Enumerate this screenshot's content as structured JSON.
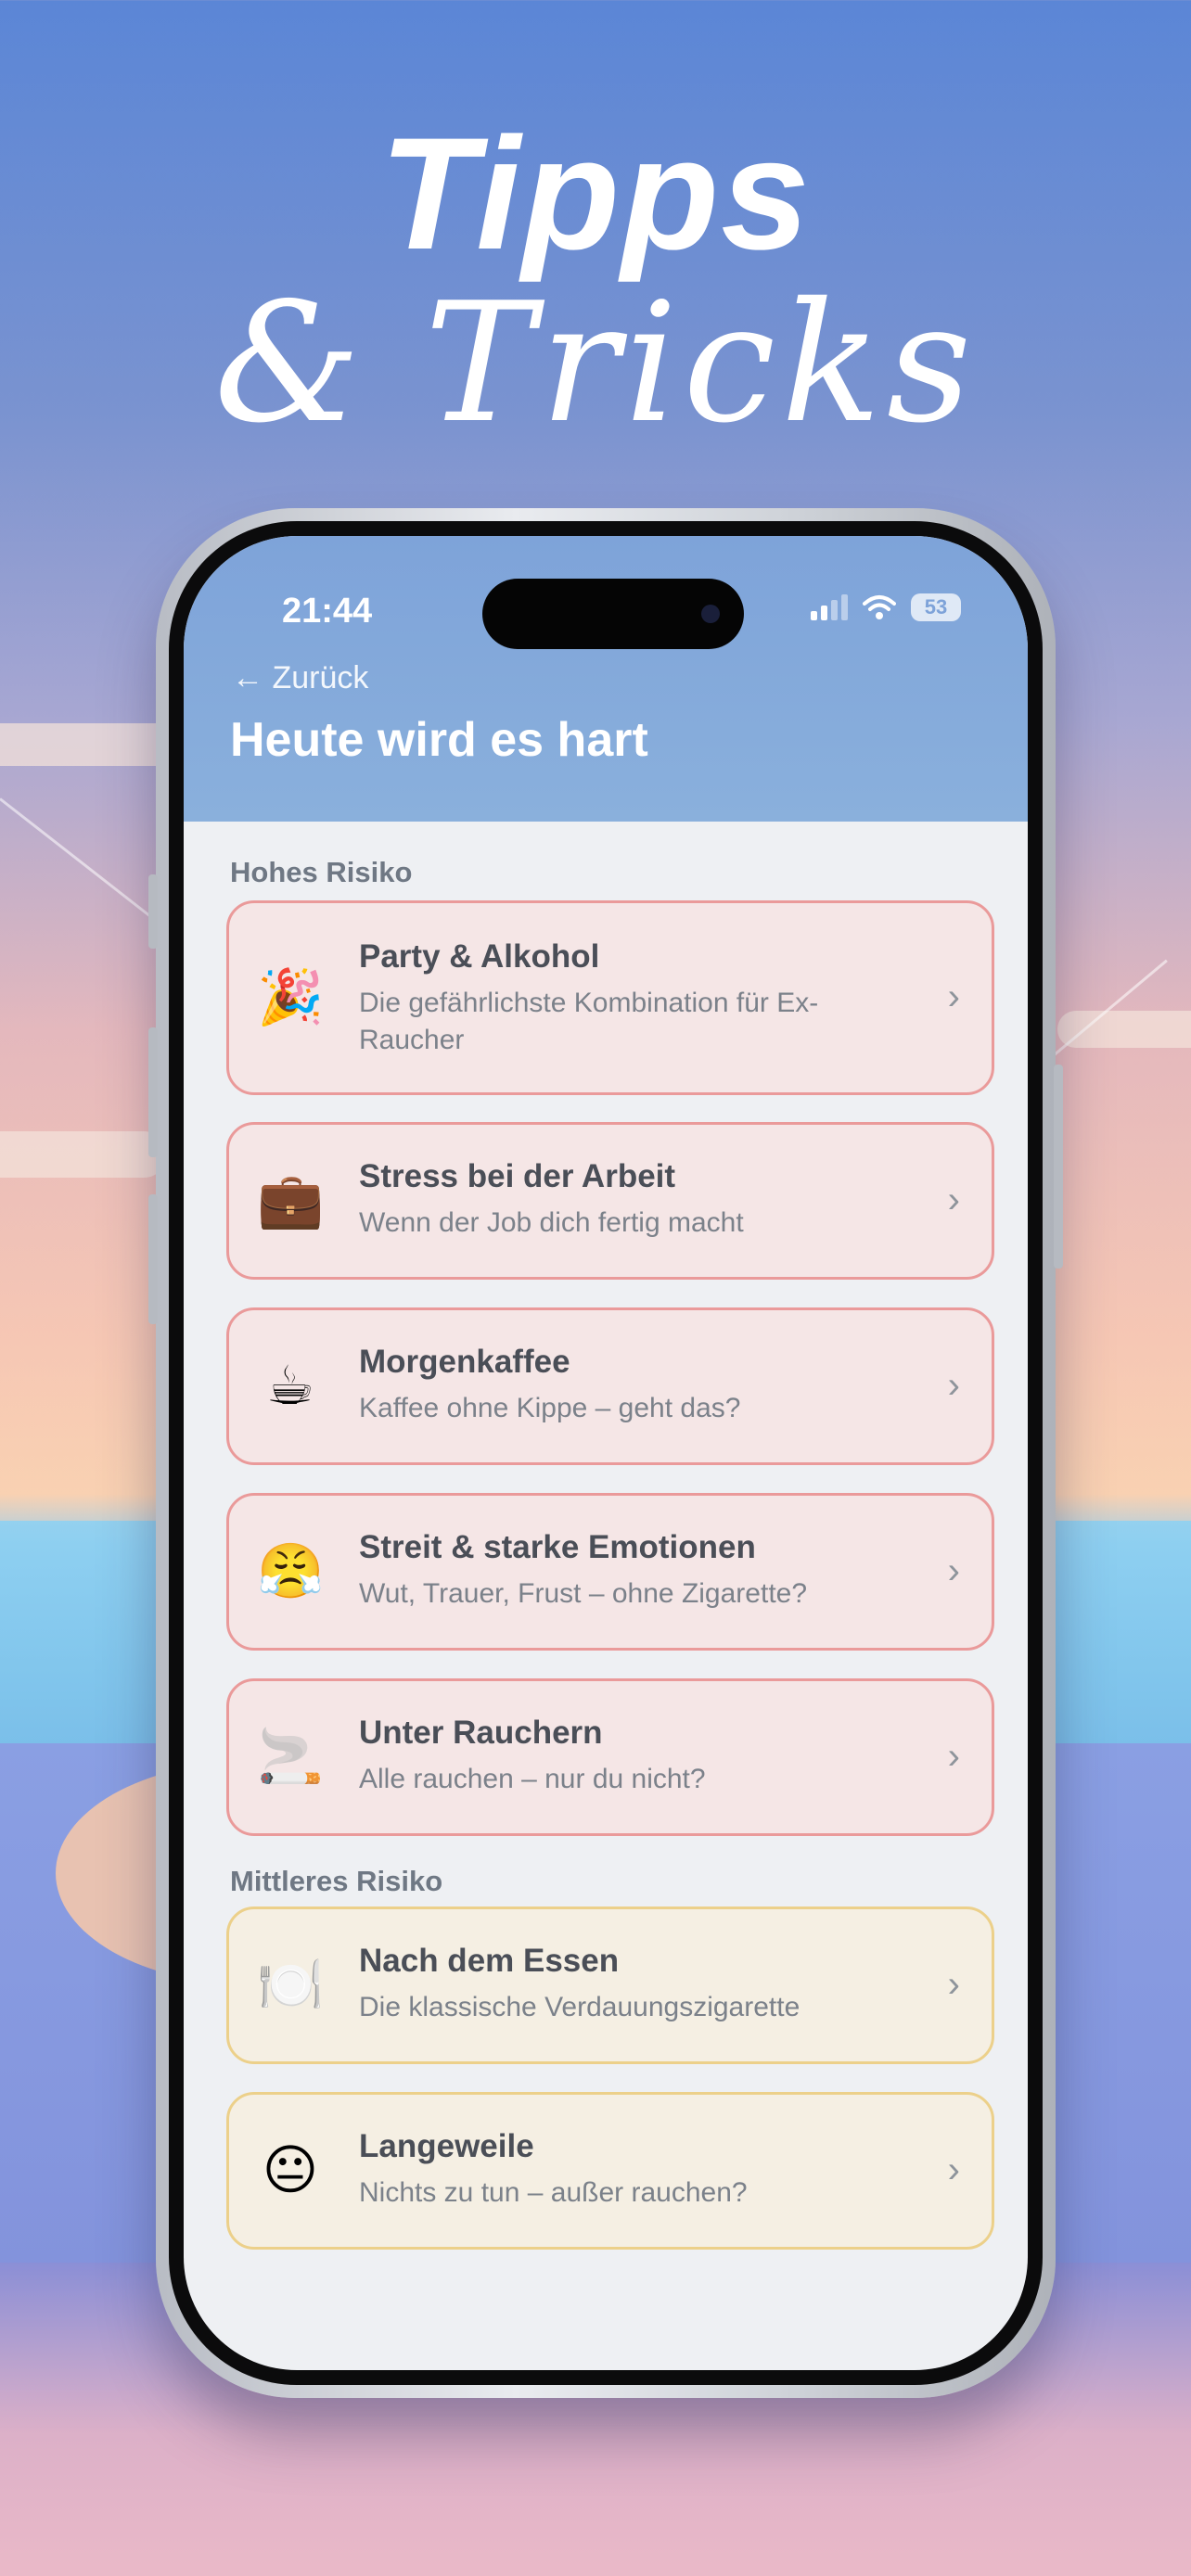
{
  "promo": {
    "headline_line1": "Tipps",
    "headline_line2": "& Tricks"
  },
  "status_bar": {
    "time": "21:44",
    "battery": "53"
  },
  "nav": {
    "back_label": "← Zurück",
    "title": "Heute wird es hart"
  },
  "sections": [
    {
      "label": "Hohes Risiko",
      "level": "high",
      "items": [
        {
          "emoji": "🎉",
          "title": "Party & Alkohol",
          "subtitle": "Die gefährlichste Kombination für Ex-Raucher"
        },
        {
          "emoji": "💼",
          "title": "Stress bei der Arbeit",
          "subtitle": "Wenn der Job dich fertig macht"
        },
        {
          "emoji": "☕",
          "title": "Morgenkaffee",
          "subtitle": "Kaffee ohne Kippe – geht das?"
        },
        {
          "emoji": "😤",
          "title": "Streit & starke Emotionen",
          "subtitle": "Wut, Trauer, Frust – ohne Zigarette?"
        },
        {
          "emoji": "🚬",
          "title": "Unter Rauchern",
          "subtitle": "Alle rauchen – nur du nicht?"
        }
      ]
    },
    {
      "label": "Mittleres Risiko",
      "level": "mid",
      "items": [
        {
          "emoji": "🍽️",
          "title": "Nach dem Essen",
          "subtitle": "Die klassische Verdauungszigarette"
        },
        {
          "emoji": "😐",
          "title": "Langeweile",
          "subtitle": "Nichts zu tun – außer rauchen?"
        }
      ]
    }
  ],
  "colors": {
    "header": "#7ea3d9",
    "high_risk_border": "#ea9a9a",
    "mid_risk_border": "#ecd08a"
  },
  "icons": {
    "chevron": "chevron-right-icon",
    "back": "arrow-left-icon"
  }
}
